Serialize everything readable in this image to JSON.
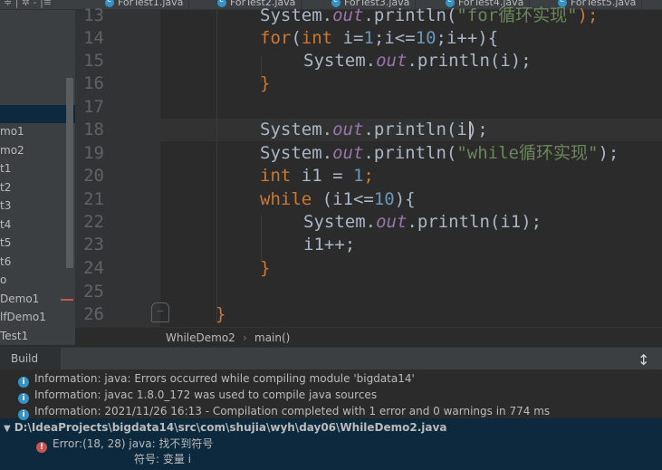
{
  "tabs": [
    {
      "label": "ForTest1.java"
    },
    {
      "label": "ForTest2.java"
    },
    {
      "label": "ForTest3.java"
    },
    {
      "label": "ForTest4.java"
    },
    {
      "label": "ForTest5.java"
    }
  ],
  "sidebar": {
    "items": [
      "mo1",
      "mo2",
      "t1",
      "t2",
      "t3",
      "t4",
      "t5",
      "t6",
      "o",
      "Demo1",
      "lfDemo1",
      "Test1"
    ]
  },
  "editor": {
    "line_numbers": [
      "13",
      "14",
      "15",
      "16",
      "17",
      "18",
      "19",
      "20",
      "21",
      "22",
      "23",
      "24",
      "25",
      "26"
    ],
    "lines": {
      "l13": {
        "a": "System.",
        "b": "out",
        "c": ".println(",
        "d": "\"for循环实现\"",
        "e": ");"
      },
      "l14": {
        "kw1": "for",
        "a": "(",
        "kw2": "int",
        "b": " i=",
        "n1": "1",
        "c": ";i<=",
        "n2": "10",
        "d": ";i++){"
      },
      "l15": {
        "a": "System.",
        "b": "out",
        "c": ".println(i);"
      },
      "l16": {
        "a": "}"
      },
      "l18": {
        "a": "System.",
        "b": "out",
        "c": ".println(i);"
      },
      "l19": {
        "a": "System.",
        "b": "out",
        "c": ".println(",
        "d": "\"while循环实现\"",
        "e": ");"
      },
      "l20": {
        "kw": "int",
        "a": " i1 = ",
        "n": "1",
        "b": ";"
      },
      "l21": {
        "kw": "while",
        "a": " (i1<=",
        "n": "10",
        "b": "){"
      },
      "l22": {
        "a": "System.",
        "b": "out",
        "c": ".println(i1);"
      },
      "l23": {
        "a": "i1++;"
      },
      "l24": {
        "a": "}"
      },
      "l26": {
        "a": "}"
      }
    }
  },
  "breadcrumb": {
    "file": "WhileDemo2",
    "method": "main()"
  },
  "build": {
    "tab_label": "Build",
    "messages": [
      "Information: java: Errors occurred while compiling module 'bigdata14'",
      "Information: javac 1.8.0_172 was used to compile java sources",
      "Information: 2021/11/26 16:13 - Compilation completed with 1 error and 0 warnings in 774 ms"
    ],
    "file_path": "D:\\IdeaProjects\\bigdata14\\src\\com\\shujia\\wyh\\day06\\WhileDemo2.java",
    "error": "Error:(18, 28)  java: 找不到符号",
    "error_detail": "符号:   变量 i"
  }
}
